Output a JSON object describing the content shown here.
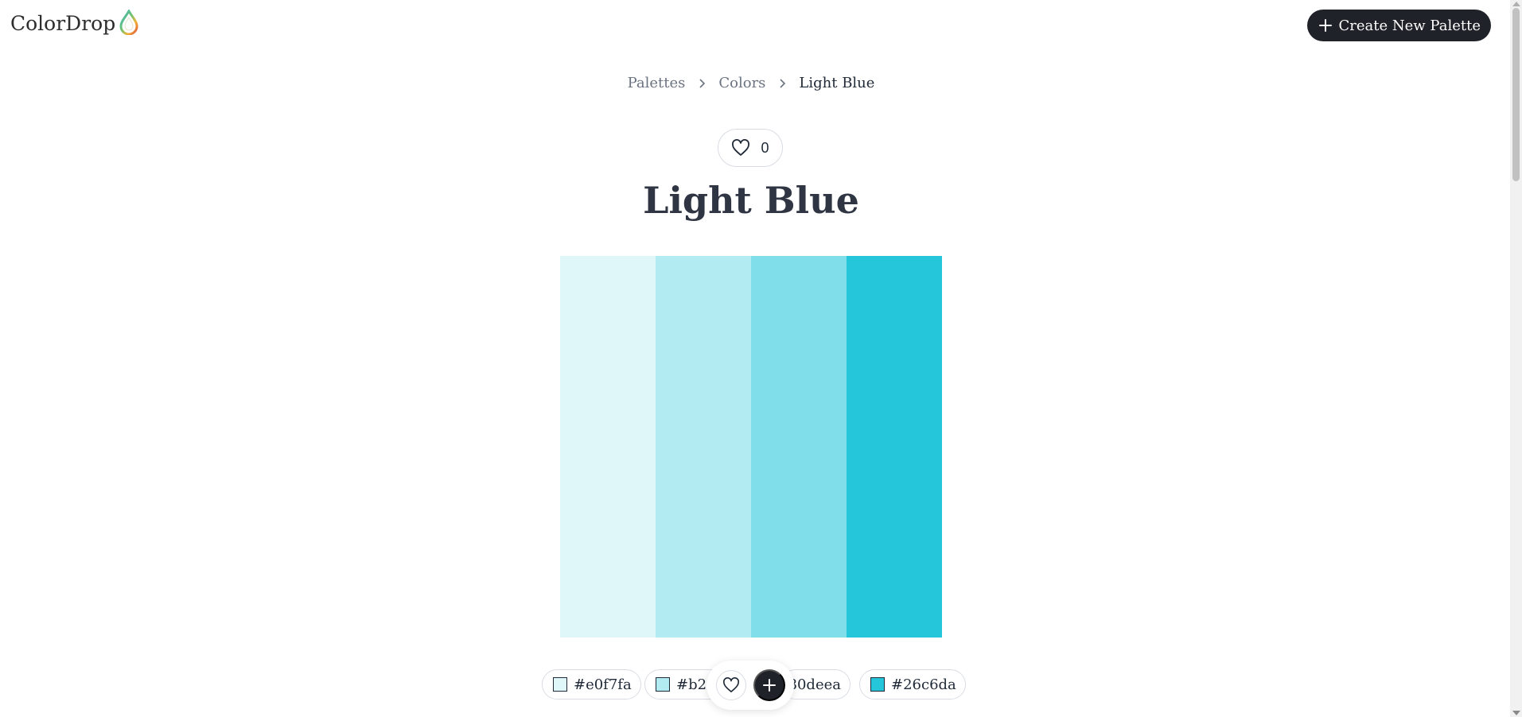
{
  "header": {
    "logo_text": "ColorDrop",
    "logo_icon": "color-drop-icon",
    "create_button_label": "Create New Palette",
    "create_button_icon": "plus-icon"
  },
  "breadcrumb": {
    "items": [
      {
        "label": "Palettes"
      },
      {
        "label": "Colors"
      }
    ],
    "current": "Light Blue",
    "separator_icon": "chevron-right-icon"
  },
  "likes": {
    "icon": "heart-icon",
    "count": "0"
  },
  "palette": {
    "title": "Light Blue",
    "colors": [
      {
        "hex": "#e0f7fa",
        "label": "#e0f7fa"
      },
      {
        "hex": "#b2ebf2",
        "label": "#b2e"
      },
      {
        "hex": "#80deea",
        "label": "80deea"
      },
      {
        "hex": "#26c6da",
        "label": "#26c6da"
      }
    ]
  },
  "floating_bar": {
    "like_icon": "heart-icon",
    "add_icon": "plus-icon"
  },
  "colors": {
    "primary_dark": "#1f2228",
    "border": "#d9dde3",
    "muted_text": "#6b7280"
  }
}
